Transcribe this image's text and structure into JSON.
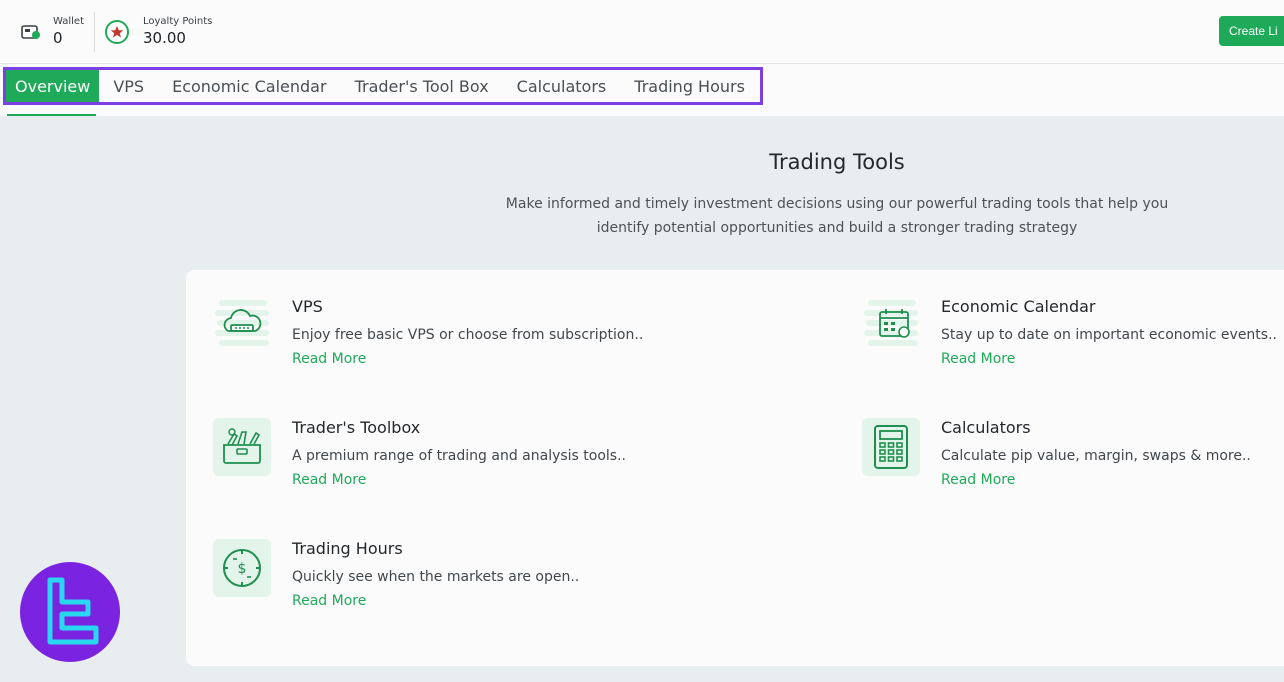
{
  "header": {
    "wallet": {
      "label": "Wallet",
      "value": "0"
    },
    "loyalty": {
      "label": "Loyalty Points",
      "value": "30.00"
    },
    "create_button": "Create Li"
  },
  "tabs": [
    {
      "label": "Overview",
      "active": true
    },
    {
      "label": "VPS"
    },
    {
      "label": "Economic Calendar"
    },
    {
      "label": "Trader's Tool Box"
    },
    {
      "label": "Calculators"
    },
    {
      "label": "Trading Hours"
    }
  ],
  "main": {
    "title": "Trading Tools",
    "description_line1": "Make informed and timely investment decisions using our powerful trading tools that help you",
    "description_line2": "identify potential opportunities and build a stronger trading strategy"
  },
  "tools": [
    {
      "name": "VPS",
      "description": "Enjoy free basic VPS or choose from subscription..",
      "link": "Read More",
      "icon": "cloud-server-icon"
    },
    {
      "name": "Economic Calendar",
      "description": "Stay up to date on important economic events..",
      "link": "Read More",
      "icon": "calendar-icon"
    },
    {
      "name": "Trader's Toolbox",
      "description": "A premium range of trading and analysis tools..",
      "link": "Read More",
      "icon": "toolbox-icon"
    },
    {
      "name": "Calculators",
      "description": "Calculate pip value, margin, swaps & more..",
      "link": "Read More",
      "icon": "calculator-icon"
    },
    {
      "name": "Trading Hours",
      "description": "Quickly see when the markets are open..",
      "link": "Read More",
      "icon": "clock-dollar-icon"
    }
  ],
  "colors": {
    "accent": "#1faa5a",
    "highlight": "#7b3fe4",
    "logo_bg": "#7a23e0",
    "logo_fg": "#2ad7f0"
  }
}
